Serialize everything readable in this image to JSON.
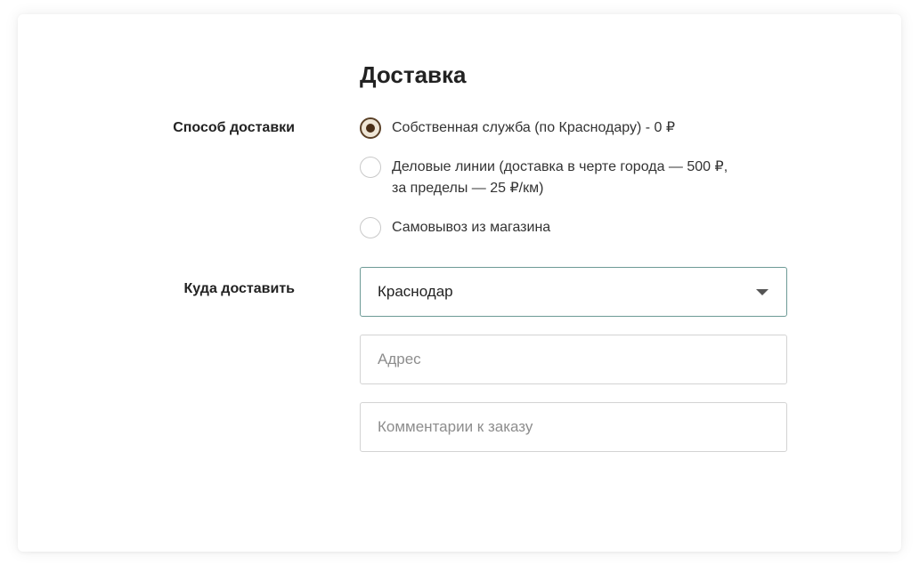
{
  "section": {
    "title": "Доставка"
  },
  "delivery_method": {
    "label": "Способ доставки",
    "options": [
      {
        "line1": "Собственная служба (по Краснодару) - 0 ₽",
        "line2": "",
        "checked": true
      },
      {
        "line1": "Деловые линии (доставка в черте города — 500 ₽,",
        "line2": "за пределы — 25 ₽/км)",
        "checked": false
      },
      {
        "line1": "Самовывоз из магазина",
        "line2": "",
        "checked": false
      }
    ]
  },
  "destination": {
    "label": "Куда доставить",
    "city_value": "Краснодар",
    "address_placeholder": "Адрес",
    "address_value": "",
    "comment_placeholder": "Комментарии к заказу",
    "comment_value": ""
  },
  "colors": {
    "radio_checked_border": "#5a4027",
    "radio_checked_fill": "#efe6d6",
    "select_border_active": "#6d9a96"
  },
  "icons": {
    "select_arrow": "chevron-down-icon"
  }
}
